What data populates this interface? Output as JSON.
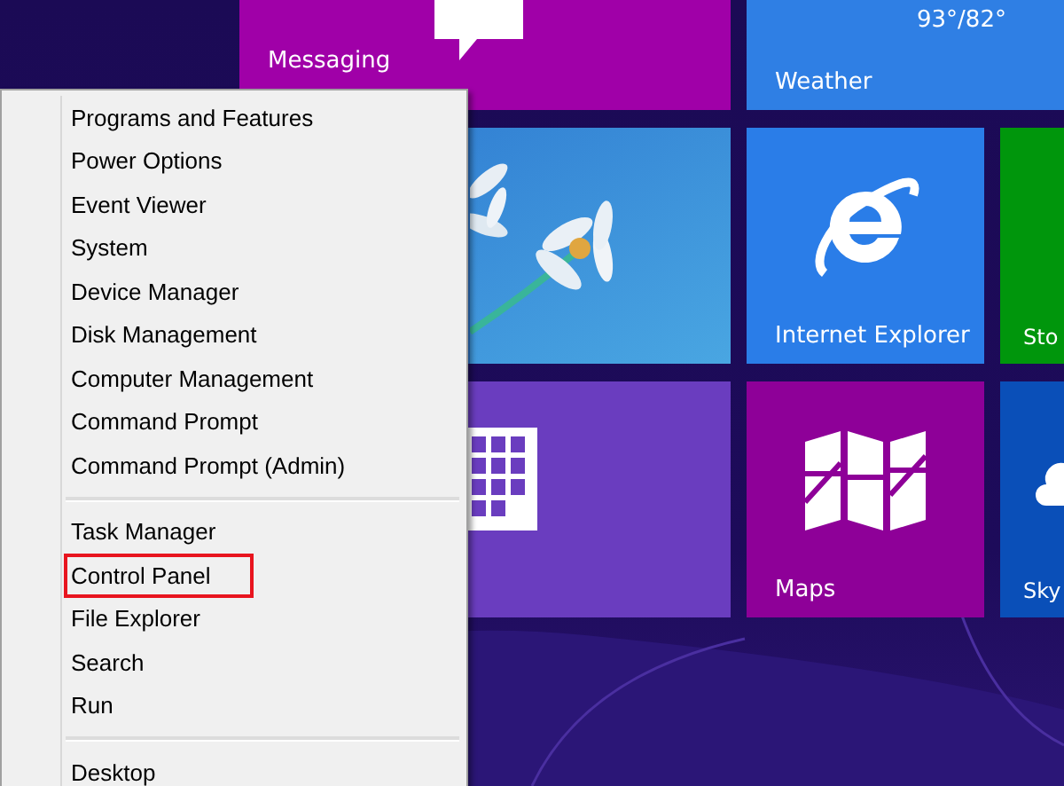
{
  "tiles": [
    {
      "kind": "app",
      "label": "Messaging",
      "color": "#a000a8"
    },
    {
      "kind": "weather",
      "label": "Weather",
      "reading": "93°/82°",
      "color": "#2f7fe4"
    },
    {
      "kind": "picture"
    },
    {
      "kind": "app",
      "label": "Internet Explorer",
      "color": "#2a7de8"
    },
    {
      "kind": "app",
      "label": "Sto",
      "color": "#00960c"
    },
    {
      "kind": "app",
      "color": "#6a3dbf"
    },
    {
      "kind": "app",
      "label": "Maps",
      "color": "#8e0098"
    },
    {
      "kind": "app",
      "label": "Sky",
      "color": "#0a4fb8"
    }
  ],
  "menu": {
    "groups": [
      [
        {
          "label": "Programs and Features",
          "highlighted": false
        },
        {
          "label": "Power Options",
          "highlighted": false
        },
        {
          "label": "Event Viewer",
          "highlighted": false
        },
        {
          "label": "System",
          "highlighted": false
        },
        {
          "label": "Device Manager",
          "highlighted": false
        },
        {
          "label": "Disk Management",
          "highlighted": false
        },
        {
          "label": "Computer Management",
          "highlighted": false
        },
        {
          "label": "Command Prompt",
          "highlighted": false
        },
        {
          "label": "Command Prompt (Admin)",
          "highlighted": false
        }
      ],
      [
        {
          "label": "Task Manager",
          "highlighted": false
        },
        {
          "label": "Control Panel",
          "highlighted": true
        },
        {
          "label": "File Explorer",
          "highlighted": false
        },
        {
          "label": "Search",
          "highlighted": false
        },
        {
          "label": "Run",
          "highlighted": false
        }
      ],
      [
        {
          "label": "Desktop",
          "highlighted": false
        }
      ]
    ]
  }
}
